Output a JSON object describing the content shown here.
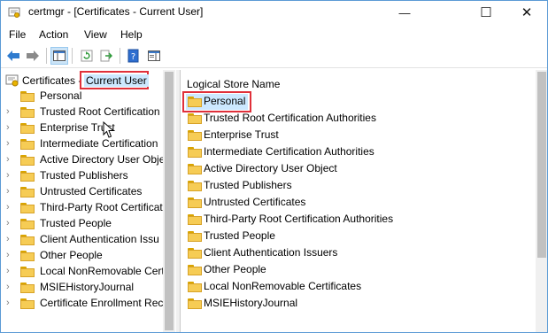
{
  "window": {
    "title": "certmgr - [Certificates - Current User]",
    "minimize": "—",
    "maximize": "☐",
    "close": "✕"
  },
  "menu": [
    "File",
    "Action",
    "View",
    "Help"
  ],
  "tree": {
    "root_prefix": "Certificates - ",
    "root_highlight": "Current User",
    "items": [
      "Personal",
      "Trusted Root Certification",
      "Enterprise Trust",
      "Intermediate Certification",
      "Active Directory User Obje",
      "Trusted Publishers",
      "Untrusted Certificates",
      "Third-Party Root Certificat",
      "Trusted People",
      "Client Authentication Issu",
      "Other People",
      "Local NonRemovable Certi",
      "MSIEHistoryJournal",
      "Certificate Enrollment Rec"
    ]
  },
  "list": {
    "column": "Logical Store Name",
    "items": [
      "Personal",
      "Trusted Root Certification Authorities",
      "Enterprise Trust",
      "Intermediate Certification Authorities",
      "Active Directory User Object",
      "Trusted Publishers",
      "Untrusted Certificates",
      "Third-Party Root Certification Authorities",
      "Trusted People",
      "Client Authentication Issuers",
      "Other People",
      "Local NonRemovable Certificates",
      "MSIEHistoryJournal"
    ]
  },
  "colors": {
    "highlight_box": "#e0303a",
    "folder": "#f6cc55",
    "selection": "#cce8ff"
  }
}
